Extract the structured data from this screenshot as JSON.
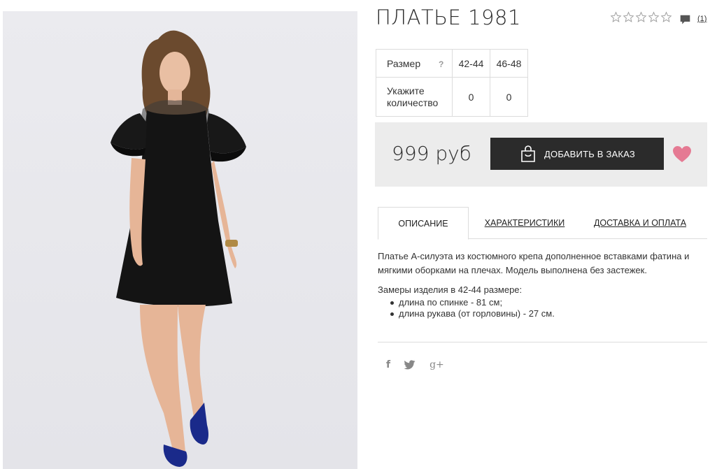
{
  "product": {
    "title": "ПЛАТЬЕ 1981",
    "rating_stars": 5,
    "rating_filled": 0,
    "comments_count": "(1)",
    "price": "999 руб"
  },
  "size_table": {
    "size_label": "Размер",
    "help_glyph": "?",
    "quantity_label_line1": "Укажите",
    "quantity_label_line2": "количество",
    "sizes": [
      "42-44",
      "46-48"
    ],
    "quantities": [
      "0",
      "0"
    ]
  },
  "order": {
    "add_button_label": "ДОБАВИТЬ В ЗАКАЗ",
    "heart_color": "#e57a93"
  },
  "tabs": [
    {
      "label": "ОПИСАНИЕ",
      "active": true
    },
    {
      "label": "ХАРАКТЕРИСТИКИ",
      "active": false
    },
    {
      "label": "ДОСТАВКА И ОПЛАТА",
      "active": false
    }
  ],
  "description": {
    "paragraph": "Платье А-силуэта из костюмного крепа дополненное вставками фатина и мягкими оборками на плечах. Модель выполнена без застежек.",
    "measures_title": "Замеры изделия в 42-44 размере:",
    "measures": [
      "длина по спинке - 81 см;",
      "длина рукава (от горловины) - 27 см."
    ]
  },
  "social": {
    "facebook_glyph": "f",
    "twitter_glyph": "t",
    "googleplus_glyph": "g+"
  },
  "colors": {
    "button_bg": "#2b2b2b",
    "order_box_bg": "#ececec",
    "border": "#dcdcdc"
  }
}
